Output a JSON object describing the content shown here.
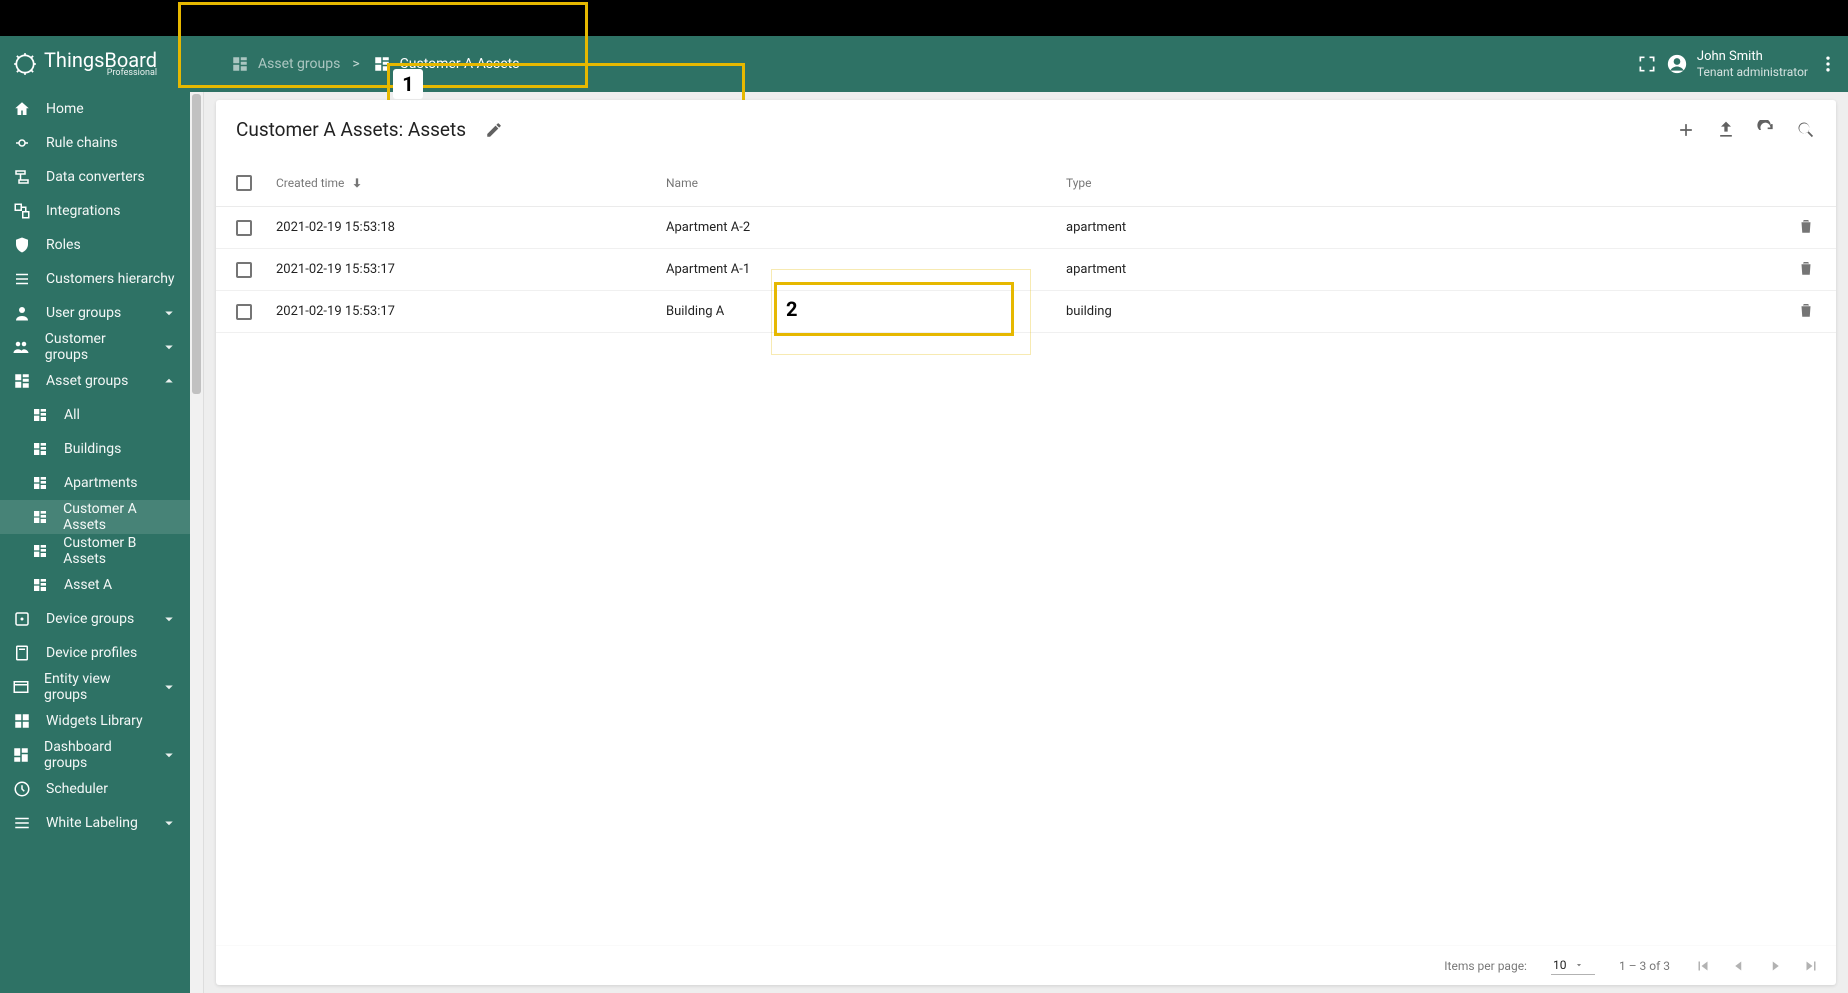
{
  "brand": {
    "name": "ThingsBoard",
    "edition": "Professional"
  },
  "user": {
    "name": "John Smith",
    "role": "Tenant administrator"
  },
  "breadcrumb": {
    "parent": "Asset groups",
    "current": "Customer A Assets"
  },
  "callout": {
    "one": "1",
    "two": "2"
  },
  "sidebar": {
    "items": [
      {
        "label": "Home",
        "icon": "home"
      },
      {
        "label": "Rule chains",
        "icon": "rulechain"
      },
      {
        "label": "Data converters",
        "icon": "converter"
      },
      {
        "label": "Integrations",
        "icon": "integration"
      },
      {
        "label": "Roles",
        "icon": "shield"
      },
      {
        "label": "Customers hierarchy",
        "icon": "hierarchy"
      },
      {
        "label": "User groups",
        "icon": "user",
        "expandable": true
      },
      {
        "label": "Customer groups",
        "icon": "people",
        "expandable": true
      },
      {
        "label": "Asset groups",
        "icon": "domain",
        "expandable": true,
        "expanded": true
      },
      {
        "label": "Device groups",
        "icon": "device",
        "expandable": true
      },
      {
        "label": "Device profiles",
        "icon": "profile"
      },
      {
        "label": "Entity view groups",
        "icon": "view",
        "expandable": true
      },
      {
        "label": "Widgets Library",
        "icon": "widgets"
      },
      {
        "label": "Dashboard groups",
        "icon": "dashboard",
        "expandable": true
      },
      {
        "label": "Scheduler",
        "icon": "schedule"
      },
      {
        "label": "White Labeling",
        "icon": "label",
        "expandable": true
      }
    ],
    "asset_subitems": [
      {
        "label": "All"
      },
      {
        "label": "Buildings"
      },
      {
        "label": "Apartments"
      },
      {
        "label": "Customer A Assets",
        "active": true
      },
      {
        "label": "Customer B Assets"
      },
      {
        "label": "Asset A"
      }
    ]
  },
  "page": {
    "title": "Customer A Assets: Assets",
    "columns": {
      "created": "Created time",
      "name": "Name",
      "type": "Type"
    },
    "rows": [
      {
        "created": "2021-02-19 15:53:18",
        "name": "Apartment A-2",
        "type": "apartment"
      },
      {
        "created": "2021-02-19 15:53:17",
        "name": "Apartment A-1",
        "type": "apartment"
      },
      {
        "created": "2021-02-19 15:53:17",
        "name": "Building A",
        "type": "building"
      }
    ]
  },
  "paginator": {
    "label": "Items per page:",
    "size": "10",
    "range": "1 – 3 of 3"
  }
}
